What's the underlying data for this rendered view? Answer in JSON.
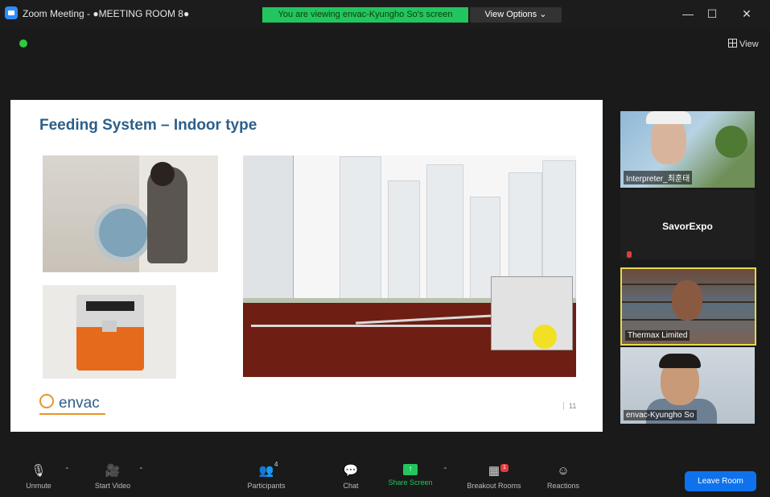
{
  "window": {
    "title": "Zoom Meeting - ●MEETING ROOM 8●",
    "minimize": "—",
    "maximize": "☐",
    "close": "✕"
  },
  "banner": {
    "viewing_text": "You are viewing envac-Kyungho So's screen",
    "view_options": "View Options ⌄"
  },
  "view_button": "View",
  "slide": {
    "title": "Feeding System – Indoor type",
    "logo_text": "envac",
    "page_number": "11"
  },
  "participants": [
    {
      "name": "Interpreter_최훈태"
    },
    {
      "name": "SavorExpo"
    },
    {
      "name": "Thermax Limited"
    },
    {
      "name": "envac-Kyungho So"
    }
  ],
  "toolbar": {
    "unmute": "Unmute",
    "start_video": "Start Video",
    "participants": "Participants",
    "participants_count": "4",
    "chat": "Chat",
    "share_screen": "Share Screen",
    "breakout_rooms": "Breakout Rooms",
    "breakout_badge": "1",
    "reactions": "Reactions",
    "leave_room": "Leave Room"
  },
  "colors": {
    "banner_green": "#22c55e",
    "leave_blue": "#0e72ed",
    "active_speaker": "#e6d94a",
    "slide_title": "#2c5f8a"
  }
}
